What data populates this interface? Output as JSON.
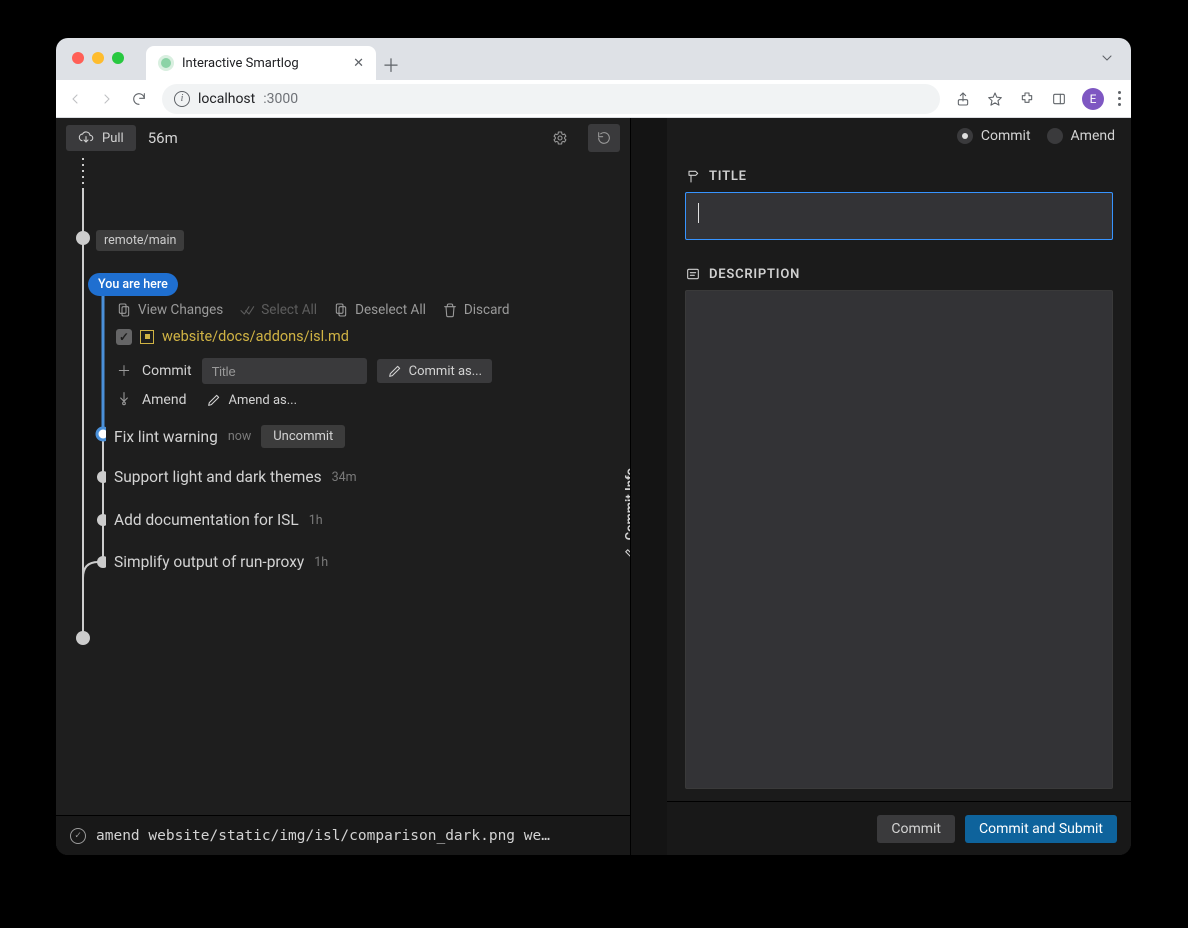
{
  "browser": {
    "tab_title": "Interactive Smartlog",
    "url_host": "localhost",
    "url_port": ":3000",
    "avatar_letter": "E"
  },
  "topbar": {
    "pull_label": "Pull",
    "time_since": "56m"
  },
  "smartlog": {
    "remote_branch": "remote/main",
    "you_are_here": "You are here",
    "wc": {
      "view_changes": "View Changes",
      "select_all": "Select All",
      "deselect_all": "Deselect All",
      "discard": "Discard",
      "file_path": "website/docs/addons/isl.md",
      "commit_action": "Commit",
      "title_placeholder": "Title",
      "commit_as": "Commit as...",
      "amend_action": "Amend",
      "amend_as": "Amend as..."
    },
    "commits": [
      {
        "msg": "Fix lint warning",
        "ago": "now",
        "pill": "Uncommit"
      },
      {
        "msg": "Support light and dark themes",
        "ago": "34m"
      },
      {
        "msg": "Add documentation for ISL",
        "ago": "1h"
      },
      {
        "msg": "Simplify output of run-proxy",
        "ago": "1h"
      }
    ],
    "side_tab": "Commit Info"
  },
  "footer": {
    "status_text": "amend website/static/img/isl/comparison_dark.png we…"
  },
  "right": {
    "mode_commit": "Commit",
    "mode_amend": "Amend",
    "title_label": "TITLE",
    "desc_label": "DESCRIPTION",
    "btn_commit": "Commit",
    "btn_commit_submit": "Commit and Submit"
  }
}
